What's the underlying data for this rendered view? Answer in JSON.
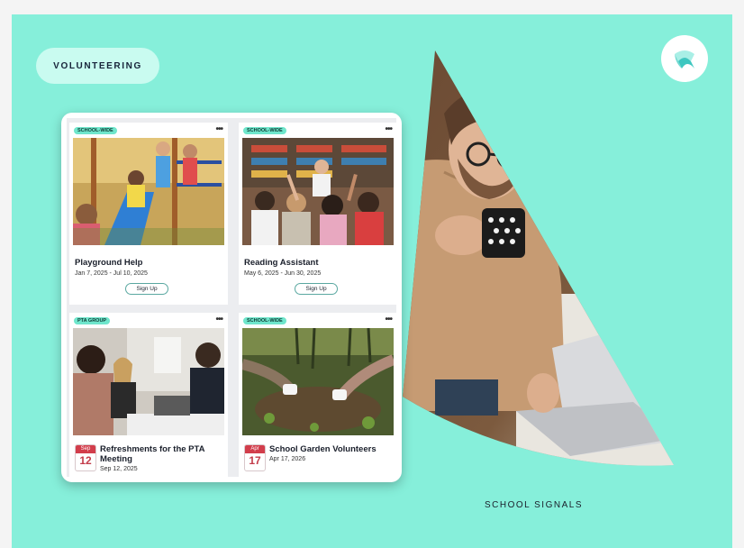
{
  "header": {
    "tag_label": "VOLUNTEERING"
  },
  "footer": {
    "brand": "SCHOOL SIGNALS"
  },
  "cards": [
    {
      "tag": "SCHOOL-WIDE",
      "menu": "•••",
      "title": "Playground Help",
      "dates": "Jan 7, 2025 - Jul 10, 2025",
      "button": "Sign Up"
    },
    {
      "tag": "SCHOOL-WIDE",
      "menu": "•••",
      "title": "Reading Assistant",
      "dates": "May 6, 2025 - Jun 30, 2025",
      "button": "Sign Up"
    },
    {
      "tag": "PTA GROUP",
      "menu": "•••",
      "cal_month": "Sep",
      "cal_day": "12",
      "title": "Refreshments for the PTA Meeting",
      "dates": "Sep 12, 2025"
    },
    {
      "tag": "SCHOOL-WIDE",
      "menu": "•••",
      "cal_month": "Apr",
      "cal_day": "17",
      "title": "School Garden Volunteers",
      "dates": "Apr 17, 2026"
    }
  ],
  "colors": {
    "background": "#86efda",
    "accent": "#6fe6cc",
    "calendar_red": "#d23d4b"
  },
  "icons": {
    "logo": "school-signals-logo",
    "menu": "more-horizontal-icon"
  }
}
